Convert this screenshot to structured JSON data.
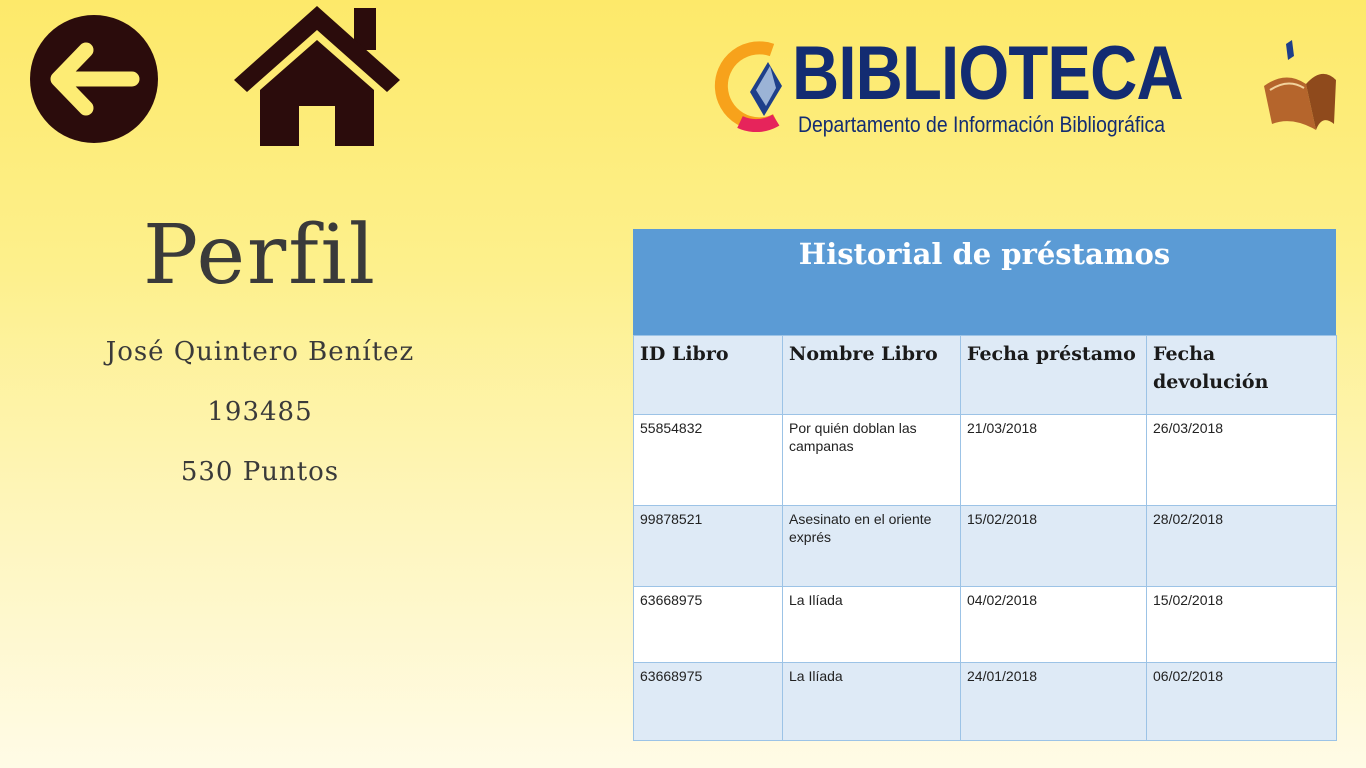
{
  "nav": {
    "back_icon": "arrow-left-circle-icon",
    "home_icon": "house-icon",
    "icon_color": "#2b0c0c"
  },
  "logo": {
    "wordmark": "BIBLIOTECA",
    "subtitle": "Departamento de Información Bibliográfica"
  },
  "profile": {
    "title": "Perfil",
    "name": "José Quintero Benítez",
    "id": "193485",
    "points": "530 Puntos"
  },
  "history": {
    "title": "Historial de préstamos",
    "columns": [
      "ID Libro",
      "Nombre Libro",
      "Fecha préstamo",
      "Fecha devolución"
    ],
    "rows": [
      {
        "id": "55854832",
        "name": "Por quién doblan las campanas",
        "loan": "21/03/2018",
        "ret": "26/03/2018"
      },
      {
        "id": "99878521",
        "name": "Asesinato en el oriente exprés",
        "loan": "15/02/2018",
        "ret": "28/02/2018"
      },
      {
        "id": "63668975",
        "name": "La Ilíada",
        "loan": "04/02/2018",
        "ret": "15/02/2018"
      },
      {
        "id": "63668975",
        "name": "La Ilíada",
        "loan": "24/01/2018",
        "ret": "06/02/2018"
      }
    ]
  },
  "colors": {
    "header_blue": "#5b9bd5",
    "row_alt": "#deeaf6",
    "logo_navy": "#132c72"
  }
}
